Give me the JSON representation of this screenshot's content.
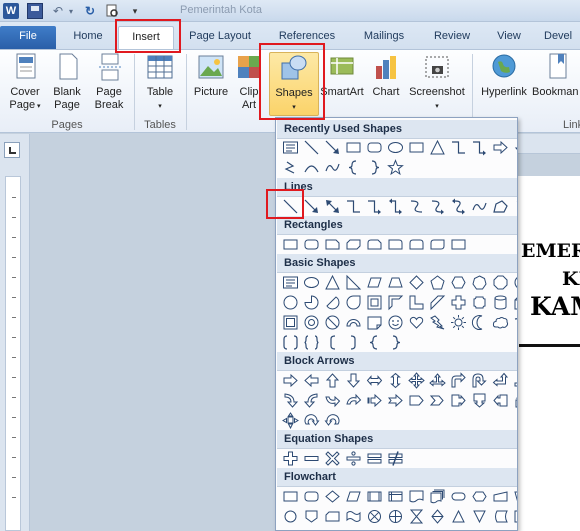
{
  "window": {
    "title": "Pemerintah Kota"
  },
  "tabs": [
    {
      "label": "File"
    },
    {
      "label": "Home"
    },
    {
      "label": "Insert"
    },
    {
      "label": "Page Layout"
    },
    {
      "label": "References"
    },
    {
      "label": "Mailings"
    },
    {
      "label": "Review"
    },
    {
      "label": "View"
    },
    {
      "label": "Devel"
    }
  ],
  "ribbon": {
    "cover_page": "Cover",
    "cover_page_2": "Page",
    "blank_page": "Blank",
    "blank_page_2": "Page",
    "page_break": "Page",
    "page_break_2": "Break",
    "table": "Table",
    "picture": "Picture",
    "clip_art": "Clip",
    "clip_art_2": "Art",
    "shapes": "Shapes",
    "smartart": "SmartArt",
    "chart": "Chart",
    "screenshot": "Screenshot",
    "hyperlink": "Hyperlink",
    "bookmark": "Bookman",
    "groups": {
      "pages": "Pages",
      "tables": "Tables",
      "links": "Link"
    }
  },
  "gallery": {
    "recent_header": "Recently Used Shapes",
    "lines_header": "Lines",
    "rectangles_header": "Rectangles",
    "basic_header": "Basic Shapes",
    "block_arrows_header": "Block Arrows",
    "equation_header": "Equation Shapes",
    "flowchart_header": "Flowchart"
  },
  "document": {
    "line1": "EMERI",
    "line2": "KI",
    "line3": "KAM"
  },
  "colors": {
    "highlight": "#e0191f",
    "file_tab": "#2a5fa8"
  }
}
